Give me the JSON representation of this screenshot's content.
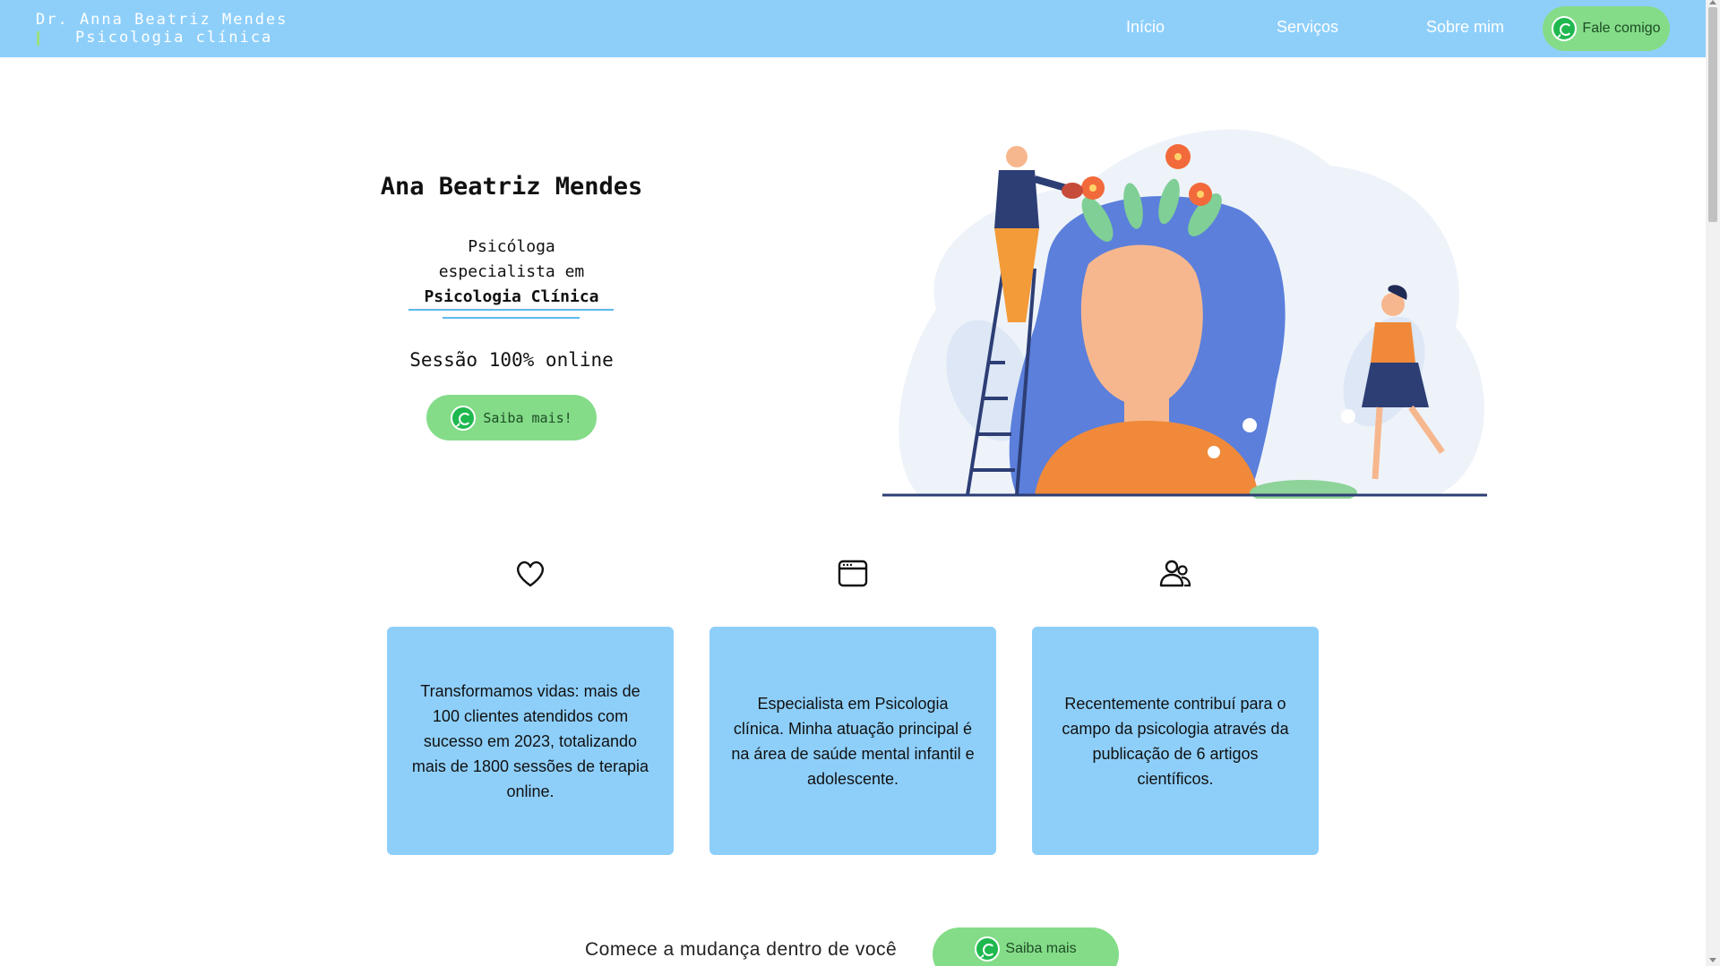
{
  "header": {
    "brand_line1": "Dr. Anna Beatriz Mendes",
    "brand_line2": "Psicologia clínica",
    "nav": {
      "inicio": "Início",
      "servicos": "Serviços",
      "sobre": "Sobre mim"
    },
    "cta_label": "Fale comigo"
  },
  "hero": {
    "name": "Ana Beatriz Mendes",
    "subtitle_line1": "Psicóloga",
    "subtitle_line2": "especialista em",
    "subtitle_line3": "Psicologia Clínica",
    "online": "Sessão 100% online",
    "button_label": "Saiba mais!"
  },
  "features": [
    {
      "icon": "heart-icon",
      "text": "Transformamos vidas: mais de 100 clientes atendidos com sucesso em 2023, totalizando mais de 1800 sessões de terapia online."
    },
    {
      "icon": "browser-window-icon",
      "text": "Especialista em Psicologia clínica. Minha atuação principal é na área de saúde mental infantil e adolescente."
    },
    {
      "icon": "users-icon",
      "text": "Recentemente contribuí para o campo da psicologia através da publicação de 6 artigos científicos."
    }
  ],
  "cta": {
    "text": "Comece a mudança dentro de você",
    "button_label": "Saiba mais"
  },
  "colors": {
    "header_bg": "#8ecffa",
    "card_bg": "#8ecffa",
    "button_green": "#84dc88",
    "whatsapp_green": "#1fb84f",
    "accent_blue": "#5cb8ee"
  }
}
